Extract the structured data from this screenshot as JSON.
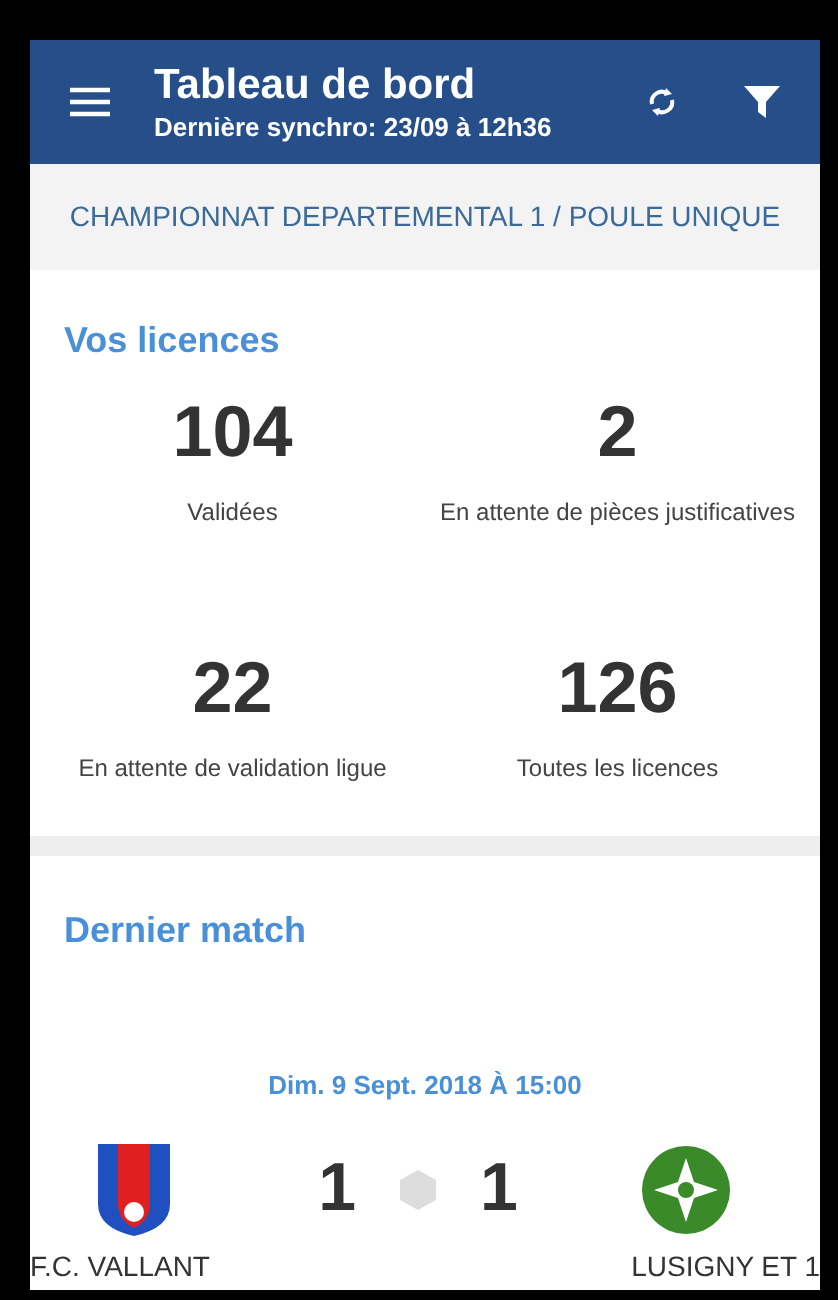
{
  "app_bar": {
    "title": "Tableau de bord",
    "subtitle": "Dernière synchro: 23/09 à 12h36"
  },
  "competition": "CHAMPIONNAT DEPARTEMENTAL 1 / POULE UNIQUE",
  "licences": {
    "title": "Vos licences",
    "stats": [
      {
        "value": "104",
        "label": "Validées"
      },
      {
        "value": "2",
        "label": "En attente de pièces justificatives"
      },
      {
        "value": "22",
        "label": "En attente de validation ligue"
      },
      {
        "value": "126",
        "label": "Toutes les licences"
      }
    ]
  },
  "last_match": {
    "title": "Dernier match",
    "date": "Dim. 9 Sept. 2018 À 15:00",
    "home": {
      "name": "F.C. VALLANT",
      "score": "1"
    },
    "away": {
      "name": "LUSIGNY ET 1",
      "score": "1"
    }
  }
}
